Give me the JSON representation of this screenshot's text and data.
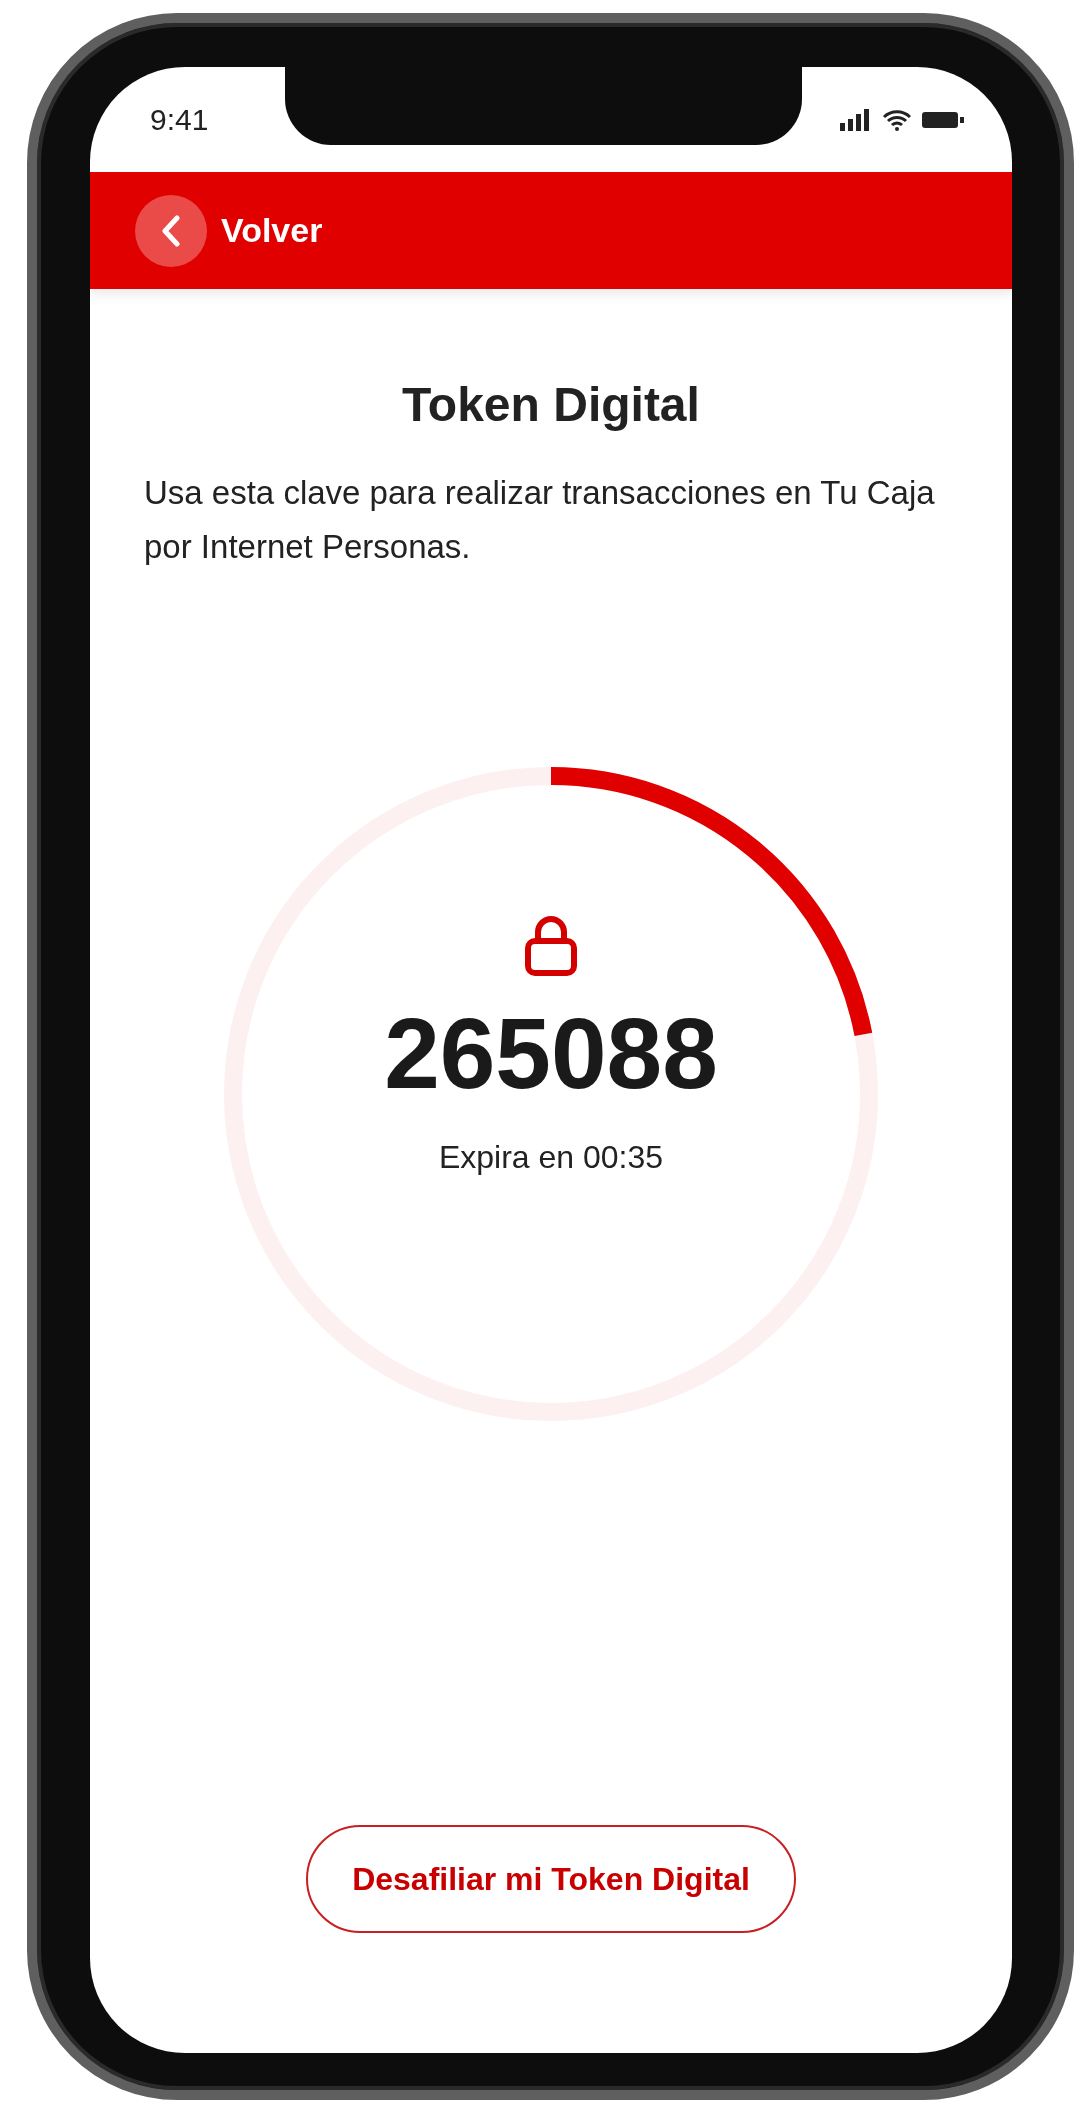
{
  "status_bar": {
    "time": "9:41"
  },
  "header": {
    "back_label": "Volver"
  },
  "title": "Token Digital",
  "description": "Usa esta clave para realizar transacciones en Tu Caja por Internet Personas.",
  "token": {
    "code": "265088",
    "expiry": "Expira en 00:35",
    "level": 0.22
  },
  "button": "Desafiliar mi Token Digital"
}
